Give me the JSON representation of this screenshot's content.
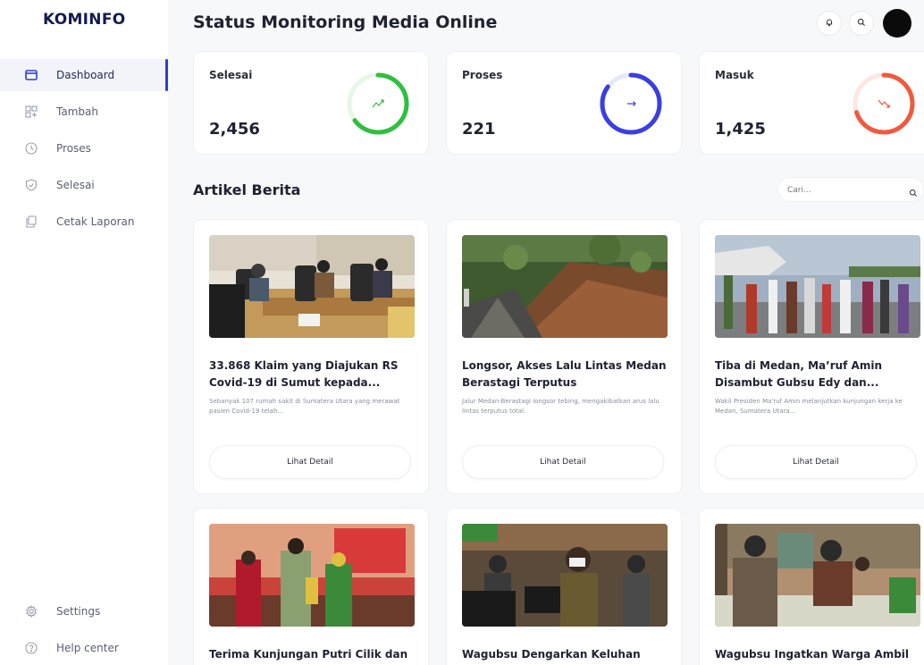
{
  "sidebar": {
    "logo": "KOMINFO",
    "items": [
      {
        "label": "Dashboard",
        "icon": "dashboard-icon",
        "active": true
      },
      {
        "label": "Tambah",
        "icon": "grid-plus-icon",
        "active": false
      },
      {
        "label": "Proses",
        "icon": "clock-icon",
        "active": false
      },
      {
        "label": "Selesai",
        "icon": "shield-check-icon",
        "active": false
      },
      {
        "label": "Cetak Laporan",
        "icon": "copy-icon",
        "active": false
      }
    ],
    "bottom": [
      {
        "label": "Settings",
        "icon": "gear-icon"
      },
      {
        "label": "Help center",
        "icon": "help-icon"
      }
    ]
  },
  "header": {
    "title": "Status Monitoring Media Online",
    "icons": [
      "bell-icon",
      "search-icon",
      "avatar"
    ]
  },
  "stats": [
    {
      "label": "Selesai",
      "value": "2,456",
      "color": "#2fbf3f",
      "icon": "trend-up-icon",
      "fill": 0.65
    },
    {
      "label": "Proses",
      "value": "221",
      "color": "#3b3fe0",
      "icon": "arrow-right-icon",
      "fill": 0.85
    },
    {
      "label": "Masuk",
      "value": "1,425",
      "color": "#f05a3c",
      "icon": "trend-down-icon",
      "fill": 0.7
    }
  ],
  "articles_section": {
    "title": "Artikel Berita",
    "search_placeholder": "Cari..."
  },
  "articles": [
    {
      "title": "33.868 Klaim yang Diajukan RS Covid-19 di Sumut kepada...",
      "desc": "Sebanyak 107 rumah sakit di Sumatera Utara yang merawat pasien Covid-19 telah...",
      "button": "Lihat Detail"
    },
    {
      "title": "Longsor, Akses Lalu Lintas Medan Berastagi Terputus",
      "desc": "Jalur Medan-Berastagi longsor tebing, mengakibatkan arus lalu lintas terputus total.",
      "button": "Lihat Detail"
    },
    {
      "title": "Tiba di Medan, Ma’ruf Amin Disambut Gubsu Edy dan...",
      "desc": "Wakil Presiden Ma'ruf Amin melanjutkan kunjungan kerja ke Medan, Sumatera Utara...",
      "button": "Lihat Detail"
    },
    {
      "title": "Terima Kunjungan Putri Cilik dan",
      "desc": "",
      "button": ""
    },
    {
      "title": "Wagubsu Dengarkan Keluhan",
      "desc": "",
      "button": ""
    },
    {
      "title": "Wagubsu Ingatkan Warga Ambil",
      "desc": "",
      "button": ""
    }
  ]
}
